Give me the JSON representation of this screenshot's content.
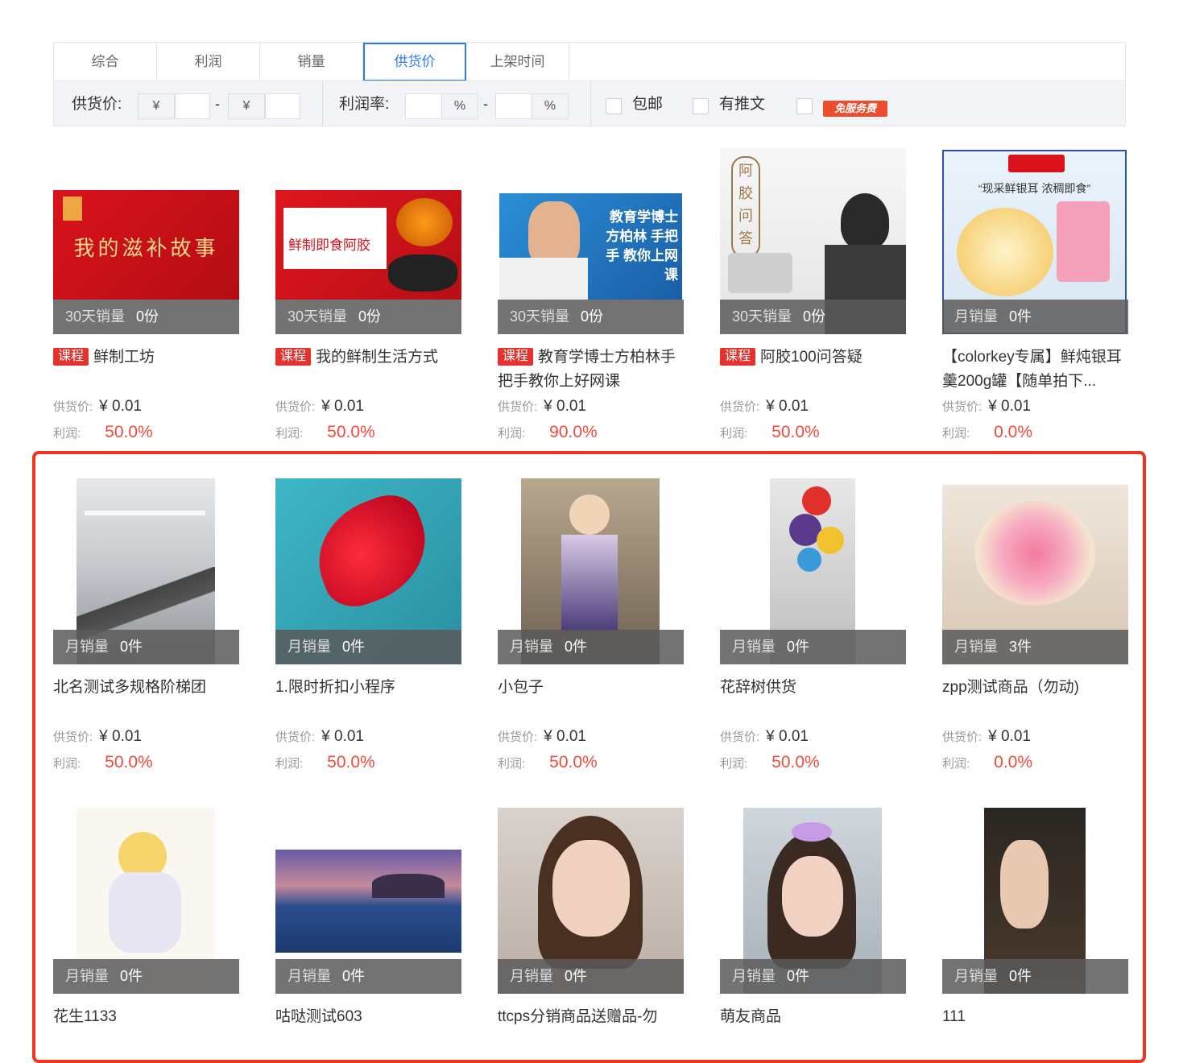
{
  "sort_tabs": [
    "综合",
    "利润",
    "销量",
    "供货价",
    "上架时间"
  ],
  "active_sort": "供货价",
  "filters": {
    "price_label": "供货价:",
    "currency": "¥",
    "dash": "-",
    "profit_label": "利润率:",
    "percent": "%",
    "free_shipping": "包邮",
    "has_article": "有推文",
    "free_service_badge": "免服务费"
  },
  "labels": {
    "supply_price": "供货价:",
    "profit": "利润:"
  },
  "products": [
    {
      "title": "鲜制工坊",
      "tag": "课程",
      "sales_label": "30天销量",
      "sales": "0份",
      "price": "¥ 0.01",
      "profit": "50.0%",
      "banner_text": "我的滋补故事"
    },
    {
      "title": "我的鲜制生活方式",
      "tag": "课程",
      "sales_label": "30天销量",
      "sales": "0份",
      "price": "¥ 0.01",
      "profit": "50.0%",
      "banner_text": "鲜制即食阿胶"
    },
    {
      "title": "教育学博士方柏林手把手教你上好网课",
      "tag": "课程",
      "sales_label": "30天销量",
      "sales": "0份",
      "price": "¥ 0.01",
      "profit": "90.0%",
      "banner_text": "教育学博士 方柏林 手把手 教你上网课"
    },
    {
      "title": "阿胶100问答疑",
      "tag": "课程",
      "sales_label": "30天销量",
      "sales": "0份",
      "price": "¥ 0.01",
      "profit": "50.0%",
      "banner_text": "阿 胶 问 答"
    },
    {
      "title": "【colorkey专属】鲜炖银耳羹200g罐【随单拍下...",
      "tag": "",
      "sales_label": "月销量",
      "sales": "0件",
      "price": "¥ 0.01",
      "profit": "0.0%",
      "banner_text": "“现采鲜银耳 浓稠即食”"
    },
    {
      "title": "北名测试多规格阶梯团",
      "tag": "",
      "sales_label": "月销量",
      "sales": "0件",
      "price": "¥ 0.01",
      "profit": "50.0%"
    },
    {
      "title": "1.限时折扣小程序",
      "tag": "",
      "sales_label": "月销量",
      "sales": "0件",
      "price": "¥ 0.01",
      "profit": "50.0%"
    },
    {
      "title": "小包子",
      "tag": "",
      "sales_label": "月销量",
      "sales": "0件",
      "price": "¥ 0.01",
      "profit": "50.0%"
    },
    {
      "title": "花辞树供货",
      "tag": "",
      "sales_label": "月销量",
      "sales": "0件",
      "price": "¥ 0.01",
      "profit": "50.0%"
    },
    {
      "title": "zpp测试商品（勿动)",
      "tag": "",
      "sales_label": "月销量",
      "sales": "3件",
      "price": "¥ 0.01",
      "profit": "0.0%"
    },
    {
      "title": "花生1133",
      "tag": "",
      "sales_label": "月销量",
      "sales": "0件",
      "price": "",
      "profit": ""
    },
    {
      "title": "咕哒测试603",
      "tag": "",
      "sales_label": "月销量",
      "sales": "0件",
      "price": "",
      "profit": ""
    },
    {
      "title": "ttcps分销商品送赠品-勿",
      "tag": "",
      "sales_label": "月销量",
      "sales": "0件",
      "price": "",
      "profit": ""
    },
    {
      "title": "萌友商品",
      "tag": "",
      "sales_label": "月销量",
      "sales": "0件",
      "price": "",
      "profit": ""
    },
    {
      "title": "111",
      "tag": "",
      "sales_label": "月销量",
      "sales": "0件",
      "price": "",
      "profit": ""
    }
  ],
  "colors": {
    "accent": "#2f7bf6",
    "profit": "#f04a3c",
    "tag": "#e5322d",
    "highlight": "#f0321e"
  }
}
